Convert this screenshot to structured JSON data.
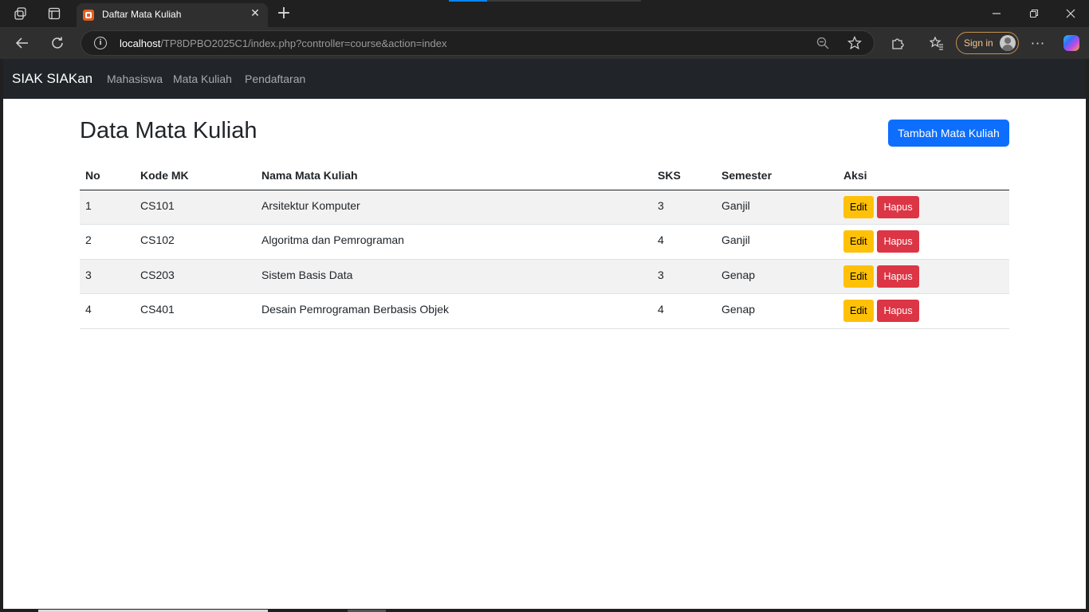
{
  "browser": {
    "tab_title": "Daftar Mata Kuliah",
    "url_host": "localhost",
    "url_path": "/TP8DPBO2025C1/index.php?controller=course&action=index",
    "sign_in_label": "Sign in",
    "icons": [
      "workspaces-icon",
      "tab-actions-icon",
      "close-icon",
      "new-tab-icon",
      "minimize-icon",
      "restore-icon",
      "close-window-icon",
      "back-icon",
      "refresh-icon",
      "info-icon",
      "zoom-out-icon",
      "favorite-star-icon",
      "extensions-icon",
      "favorites-icon",
      "avatar-icon",
      "more-icon",
      "copilot-icon"
    ]
  },
  "navbar": {
    "brand": "SIAK SIAKan",
    "links": [
      "Mahasiswa",
      "Mata Kuliah",
      "Pendaftaran"
    ]
  },
  "main": {
    "title": "Data Mata Kuliah",
    "add_button": "Tambah Mata Kuliah",
    "table": {
      "headers": [
        "No",
        "Kode MK",
        "Nama Mata Kuliah",
        "SKS",
        "Semester",
        "Aksi"
      ],
      "rows": [
        {
          "no": "1",
          "kode": "CS101",
          "nama": "Arsitektur Komputer",
          "sks": "3",
          "semester": "Ganjil"
        },
        {
          "no": "2",
          "kode": "CS102",
          "nama": "Algoritma dan Pemrograman",
          "sks": "4",
          "semester": "Ganjil"
        },
        {
          "no": "3",
          "kode": "CS203",
          "nama": "Sistem Basis Data",
          "sks": "3",
          "semester": "Genap"
        },
        {
          "no": "4",
          "kode": "CS401",
          "nama": "Desain Pemrograman Berbasis Objek",
          "sks": "4",
          "semester": "Genap"
        }
      ],
      "edit_label": "Edit",
      "delete_label": "Hapus"
    }
  },
  "colors": {
    "navbar_bg": "#212529",
    "primary": "#0d6efd",
    "warning": "#ffc107",
    "danger": "#dc3545",
    "browser_frame": "#202020"
  }
}
